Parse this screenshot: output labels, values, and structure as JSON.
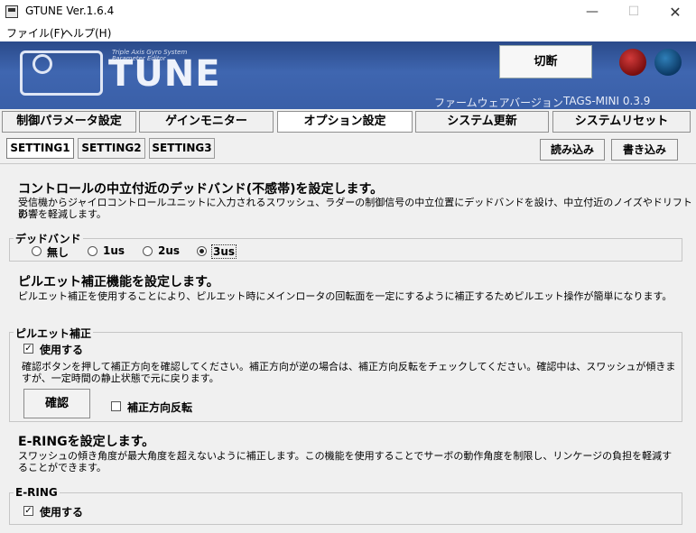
{
  "window": {
    "title": "GTUNE Ver.1.6.4",
    "minimize": "—",
    "maximize": "☐",
    "close": "✕"
  },
  "menu": [
    "ファイル(F)",
    "ヘルプ(H)"
  ],
  "header": {
    "logo_text": "TUNE",
    "logo_tagline_1": "Triple Axis Gyro System",
    "logo_tagline_2": "Parameter Editor",
    "disconnect_label": "切断",
    "firmware_label": "ファームウェアバージョン",
    "firmware_value": "TAGS-MINI  0.3.9",
    "led_red": "#c0282a",
    "led_blue": "#1d5f99"
  },
  "main_tabs": [
    "制御パラメータ設定",
    "ゲインモニター",
    "オプション設定",
    "システム更新",
    "システムリセット"
  ],
  "main_tab_active": "オプション設定",
  "setting_tabs": [
    "SETTING1",
    "SETTING2",
    "SETTING3"
  ],
  "setting_tab_active": "SETTING1",
  "actions": {
    "read": "読み込み",
    "write": "書き込み"
  },
  "deadband": {
    "heading": "コントロールの中立付近のデッドバンド(不感帯)を設定します。",
    "desc_line1": "受信機からジャイロコントロールユニットに入力されるスワッシュ、ラダーの制御信号の中立位置にデッドバンドを設け、中立付近のノイズやドリフトの",
    "desc_line2": "影響を軽減します。",
    "group_label": "デッドバンド",
    "options": [
      "無し",
      "1us",
      "2us",
      "3us"
    ],
    "selected": "3us"
  },
  "pirouette": {
    "heading": "ピルエット補正機能を設定します。",
    "desc": "ピルエット補正を使用することにより、ピルエット時にメインロータの回転面を一定にするように補正するためピルエット操作が簡単になります。",
    "group_label": "ピルエット補正",
    "use_label": "使用する",
    "use_checked": true,
    "instr_line1": "確認ボタンを押して補正方向を確認してください。補正方向が逆の場合は、補正方向反転をチェックしてください。確認中は、スワッシュが傾きま",
    "instr_line2": "すが、一定時間の静止状態で元に戻ります。",
    "confirm_button": "確認",
    "reverse_label": "補正方向反転",
    "reverse_checked": false
  },
  "ering": {
    "heading": "E-RINGを設定します。",
    "desc_line1": "スワッシュの傾き角度が最大角度を超えないように補正します。この機能を使用することでサーボの動作角度を制限し、リンケージの負担を軽減す",
    "desc_line2": "ることができます。",
    "group_label": "E-RING",
    "use_label": "使用する",
    "use_checked": true
  }
}
